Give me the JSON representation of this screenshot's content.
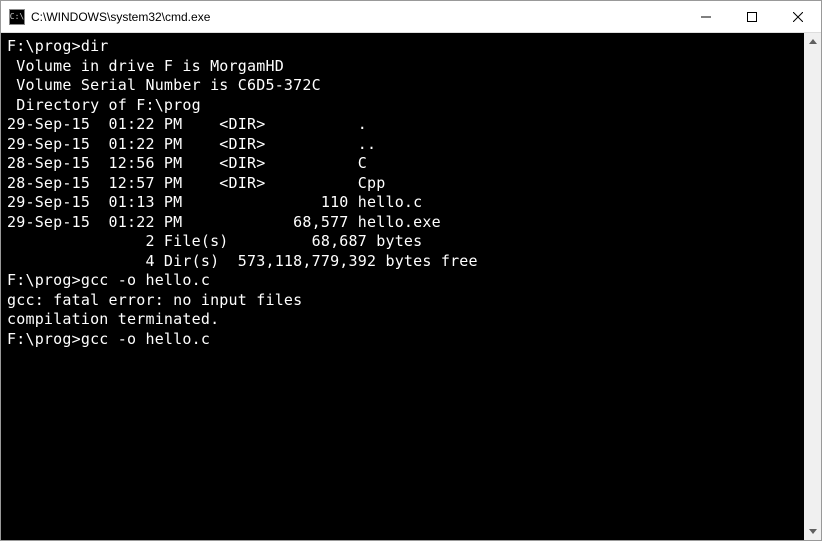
{
  "window": {
    "title": "C:\\WINDOWS\\system32\\cmd.exe"
  },
  "console": {
    "prompt1": "F:\\prog>dir",
    "vol_line": " Volume in drive F is MorgamHD",
    "serial_line": " Volume Serial Number is C6D5-372C",
    "blank1": "",
    "dir_of": " Directory of F:\\prog",
    "blank2": "",
    "row_dot": "29-Sep-15  01:22 PM    <DIR>          .",
    "row_dotdot": "29-Sep-15  01:22 PM    <DIR>          ..",
    "row_c": "28-Sep-15  12:56 PM    <DIR>          C",
    "row_cpp": "28-Sep-15  12:57 PM    <DIR>          Cpp",
    "row_helloc": "29-Sep-15  01:13 PM               110 hello.c",
    "row_helloe": "29-Sep-15  01:22 PM            68,577 hello.exe",
    "summary_files": "               2 File(s)         68,687 bytes",
    "summary_dirs": "               4 Dir(s)  573,118,779,392 bytes free",
    "blank3": "",
    "prompt2": "F:\\prog>gcc -o hello.c",
    "gcc_err1": "gcc: fatal error: no input files",
    "gcc_err2": "compilation terminated.",
    "blank4": "",
    "prompt3": "F:\\prog>gcc -o hello.c"
  }
}
